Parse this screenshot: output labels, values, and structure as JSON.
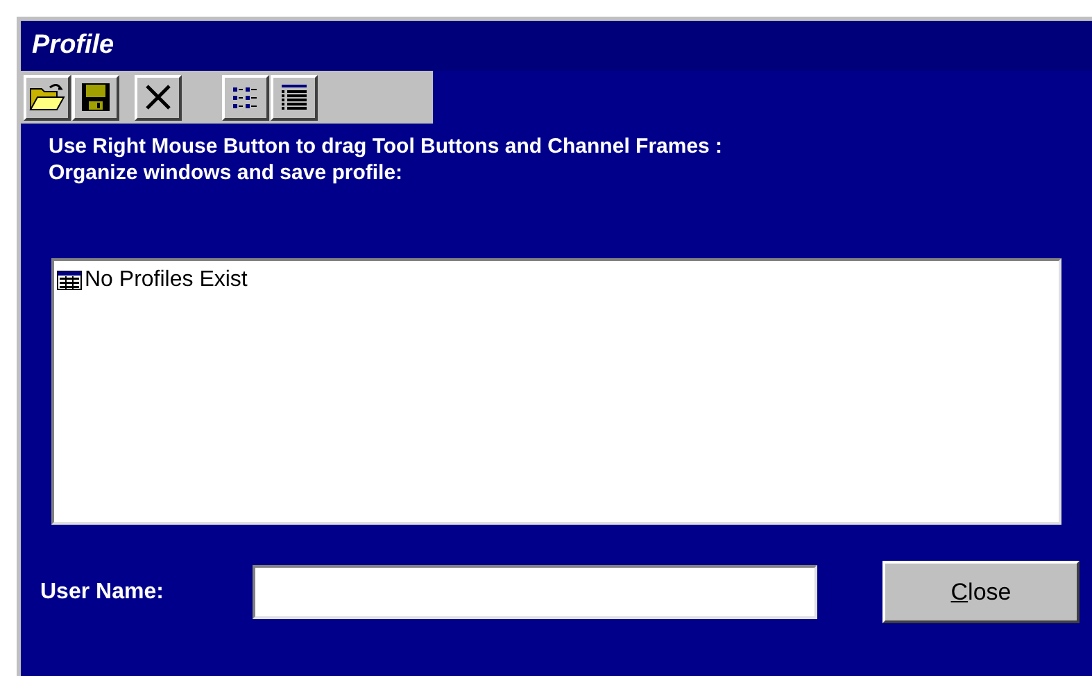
{
  "window": {
    "title": "Profile"
  },
  "toolbar": [
    {
      "kind": "open"
    },
    {
      "kind": "save"
    },
    {
      "kind": "delete"
    },
    {
      "kind": "list"
    },
    {
      "kind": "details"
    }
  ],
  "instructions": [
    "Use Right Mouse Button to drag Tool Buttons and Channel Frames :",
    "Organize windows and save profile:"
  ],
  "profiles": [
    {
      "label": "No Profiles Exist"
    }
  ],
  "user_name": {
    "label": "User Name:"
  },
  "close_button": {
    "label": "Close"
  }
}
